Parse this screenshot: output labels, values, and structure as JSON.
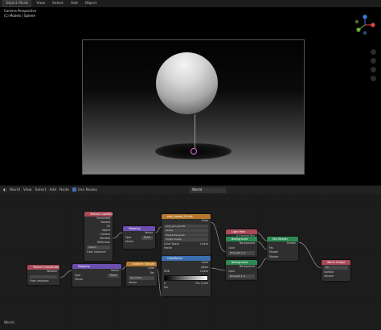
{
  "viewport_header": {
    "mode": "Object Mode",
    "menus": [
      "View",
      "Select",
      "Add",
      "Object"
    ]
  },
  "viewport_info": {
    "line1": "Camera Perspective",
    "line2": "(1) Models | Sphere"
  },
  "node_header": {
    "editor": "World",
    "menus": [
      "View",
      "Select",
      "Add",
      "Node"
    ],
    "use_nodes": "Use Nodes",
    "world_name": "World"
  },
  "footer": {
    "label": "World"
  },
  "nodes": {
    "texcoord_top": {
      "title": "Texture Coordinate",
      "outputs": [
        "Generated",
        "Normal",
        "UV",
        "Object",
        "Camera",
        "Window",
        "Reflection"
      ],
      "object_label": "Object",
      "from_instancer": "From Instancer"
    },
    "mapping_top": {
      "title": "Mapping",
      "output": "Vector",
      "type_label": "Type",
      "type_value": "Point",
      "input": "Vector"
    },
    "env_texture": {
      "title": "poly_haven_2k.hdr",
      "color": "Color",
      "file": "poly_pan_2k.hdr",
      "interp": "Linear",
      "proj": "Equirectangular",
      "source": "Single Image",
      "colorspace_label": "Color Space",
      "colorspace": "Linear",
      "vector": "Vector"
    },
    "light_path": {
      "title": "Light Path",
      "output": "Is Camera Ray"
    },
    "bg1": {
      "title": "Background",
      "out": "Background",
      "color": "Color",
      "strength": "Strength 1.0"
    },
    "bg2": {
      "title": "Background",
      "out": "Background",
      "color": "Color",
      "strength": "Strength 1.0"
    },
    "mix": {
      "title": "Mix Shader",
      "out": "Shader",
      "fac": "Fac",
      "s1": "Shader",
      "s2": "Shader"
    },
    "world_output": {
      "title": "World Output",
      "target": "All",
      "surface": "Surface",
      "volume": "Volume"
    },
    "texcoord_bottom": {
      "title": "Texture Coordinate",
      "output": "Window",
      "from_instancer": "From Instancer"
    },
    "mapping_bottom": {
      "title": "Mapping",
      "output": "Vector",
      "type_label": "Type",
      "type_value": "Point",
      "input": "Vector"
    },
    "gradient": {
      "title": "Gradient Texture",
      "color": "Color",
      "fac": "Fac",
      "type": "Quadratic",
      "vector": "Vector"
    },
    "colorramp": {
      "title": "ColorRamp",
      "color": "Color",
      "alpha": "Alpha",
      "mode": "RGB",
      "interp": "Linear",
      "index": "0",
      "pos_label": "Pos",
      "pos": "0.000",
      "fac": "Fac"
    }
  },
  "colors": {
    "texcoord_header": "#a84a58",
    "vector_header": "#6b4fb0",
    "texture_header": "#b5792d",
    "input_header": "#a84a58",
    "shader_header": "#2e8a52",
    "output_header": "#a84a58",
    "converter_header": "#3d6fb0",
    "link": "#9a9a9a"
  }
}
